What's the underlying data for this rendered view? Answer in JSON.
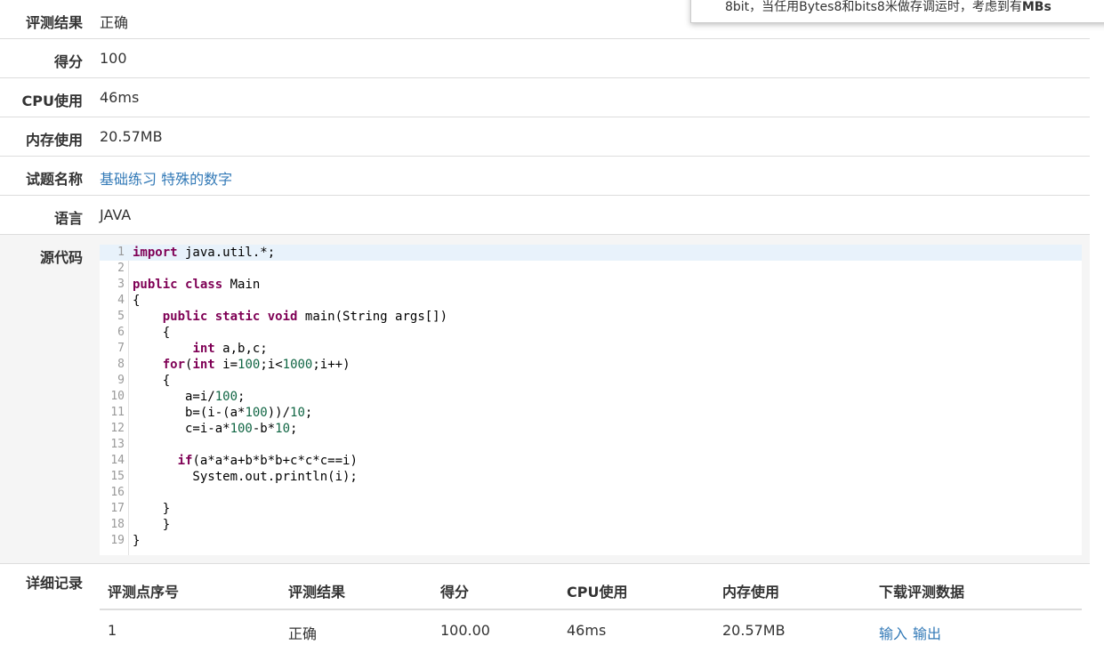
{
  "result": {
    "verdict_label": "评测结果",
    "verdict_value": "正确",
    "score_label": "得分",
    "score_value": "100",
    "cpu_label": "CPU使用",
    "cpu_value": "46ms",
    "memory_label": "内存使用",
    "memory_value": "20.57MB",
    "problem_label": "试题名称",
    "problem_value": "基础练习 特殊的数字",
    "language_label": "语言",
    "language_value": "JAVA",
    "source_label": "源代码"
  },
  "code": {
    "lines": [
      "import java.util.*;",
      "",
      "public class Main",
      "{",
      "    public static void main(String args[])",
      "    {",
      "        int a,b,c;",
      "    for(int i=100;i<1000;i++)",
      "    {",
      "       a=i/100;",
      "       b=(i-(a*100))/10;",
      "       c=i-a*100-b*10;",
      "",
      "      if(a*a*a+b*b*b+c*c*c==i)",
      "        System.out.println(i);",
      "",
      "    }",
      "    }",
      "}"
    ]
  },
  "details": {
    "section_label": "详细记录",
    "headers": [
      "评测点序号",
      "评测结果",
      "得分",
      "CPU使用",
      "内存使用",
      "下载评测数据"
    ],
    "rows": [
      {
        "index": "1",
        "verdict": "正确",
        "score": "100.00",
        "cpu": "46ms",
        "memory": "20.57MB",
        "input_link": "输入",
        "output_link": "输出"
      }
    ]
  },
  "popup": {
    "text_start": "8bit，当任用Bytes8和bits8米做存调运时，",
    "text_end": "考虑到有",
    "text_bold": "MBs"
  },
  "colors": {
    "link": "#337ab7",
    "keyword": "#7f0055",
    "number": "#116644",
    "active_line": "#e8f2fb"
  }
}
